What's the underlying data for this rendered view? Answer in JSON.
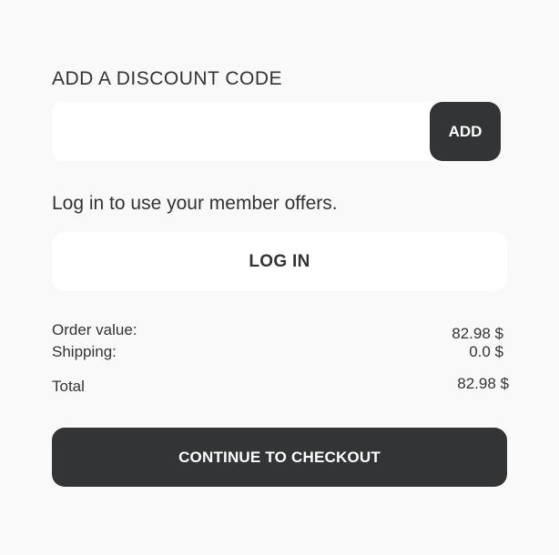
{
  "discount": {
    "label": "ADD A DISCOUNT CODE",
    "input_value": "",
    "input_placeholder": "",
    "add_label": "ADD"
  },
  "member": {
    "text": "Log in to use your member offers.",
    "login_label": "LOG IN"
  },
  "summary": {
    "order_value_label": "Order value:",
    "order_value": "82.98 $",
    "shipping_label": "Shipping:",
    "shipping_value": "0.0 $",
    "total_label": "Total",
    "total_value": "82.98 $"
  },
  "checkout": {
    "continue_label": "CONTINUE TO CHECKOUT"
  },
  "colors": {
    "background": "#f9f9f9",
    "button_dark": "#333435",
    "button_light": "#ffffff",
    "text": "#333333"
  }
}
